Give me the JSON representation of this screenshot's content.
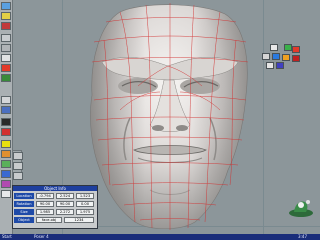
{
  "app": {
    "title": ""
  },
  "info_panel": {
    "title": "Object Info",
    "rows": [
      {
        "label": "Location",
        "values": [
          "-0.794",
          "2.524",
          "1.523"
        ]
      },
      {
        "label": "Rotation",
        "values": [
          "90.00",
          "90.00",
          "0.00"
        ]
      },
      {
        "label": "Size",
        "values": [
          "1.985",
          "2.272",
          "1.975"
        ]
      }
    ],
    "object_label": "Object",
    "object_name": "face.obj",
    "extra": "1234"
  },
  "statusbar": {
    "start": "Start",
    "app": "Poser 4",
    "time": "3:47"
  },
  "icons": {
    "left_toolbar": [
      "move-icon",
      "rotate-icon",
      "scale-icon",
      "select-icon",
      "camera-icon",
      "light-icon",
      "render-icon",
      "material-icon",
      "zoom-icon",
      "pan-icon",
      "grid-icon",
      "wire-icon",
      "shade-icon",
      "texture-icon",
      "bone-icon",
      "morph-icon",
      "paint-icon",
      "layer-icon"
    ],
    "palette": [
      "paint-bucket-icon",
      "brush-icon",
      "eraser-icon",
      "eyedropper-icon",
      "smooth-icon",
      "stamp-icon"
    ]
  },
  "colors": {
    "viewport": "#8c969a",
    "wire": "#d23030",
    "panel_blue": "#1e4aa8",
    "statusbar": "#1a2d7a"
  }
}
